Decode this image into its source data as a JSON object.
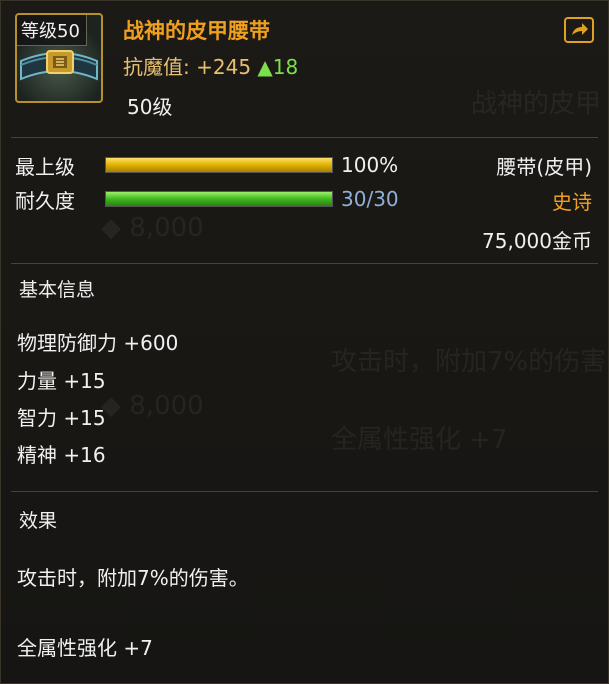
{
  "item": {
    "level_badge": "等级50",
    "name": "战神的皮甲腰带",
    "magic_resist_label": "抗魔值:",
    "magic_resist_value": "+245",
    "magic_resist_delta": "▲18",
    "required_level": "50级"
  },
  "bars": {
    "grade_label": "最上级",
    "grade_value": "100%",
    "grade_fraction": 1.0,
    "durability_label": "耐久度",
    "durability_value": "30/30",
    "durability_fraction": 1.0
  },
  "details": {
    "type": "腰带(皮甲)",
    "rarity": "史诗",
    "price": "75,000金币"
  },
  "basic_info": {
    "title": "基本信息",
    "attributes": [
      "物理防御力 +600",
      "力量 +15",
      "智力 +15",
      "精神 +16"
    ]
  },
  "effect": {
    "title": "效果",
    "description": "攻击时，附加7%的伤害。",
    "extra": "全属性强化 +7"
  },
  "icons": [
    "belt-icon",
    "share-icon"
  ],
  "colors": {
    "item_name": "#f0a020",
    "rarity": "#f0a020",
    "grade_bar": "#e0b000",
    "durability_bar": "#3fb81e",
    "durability_text": "#8fb0d8",
    "delta_up": "#7be04a"
  }
}
